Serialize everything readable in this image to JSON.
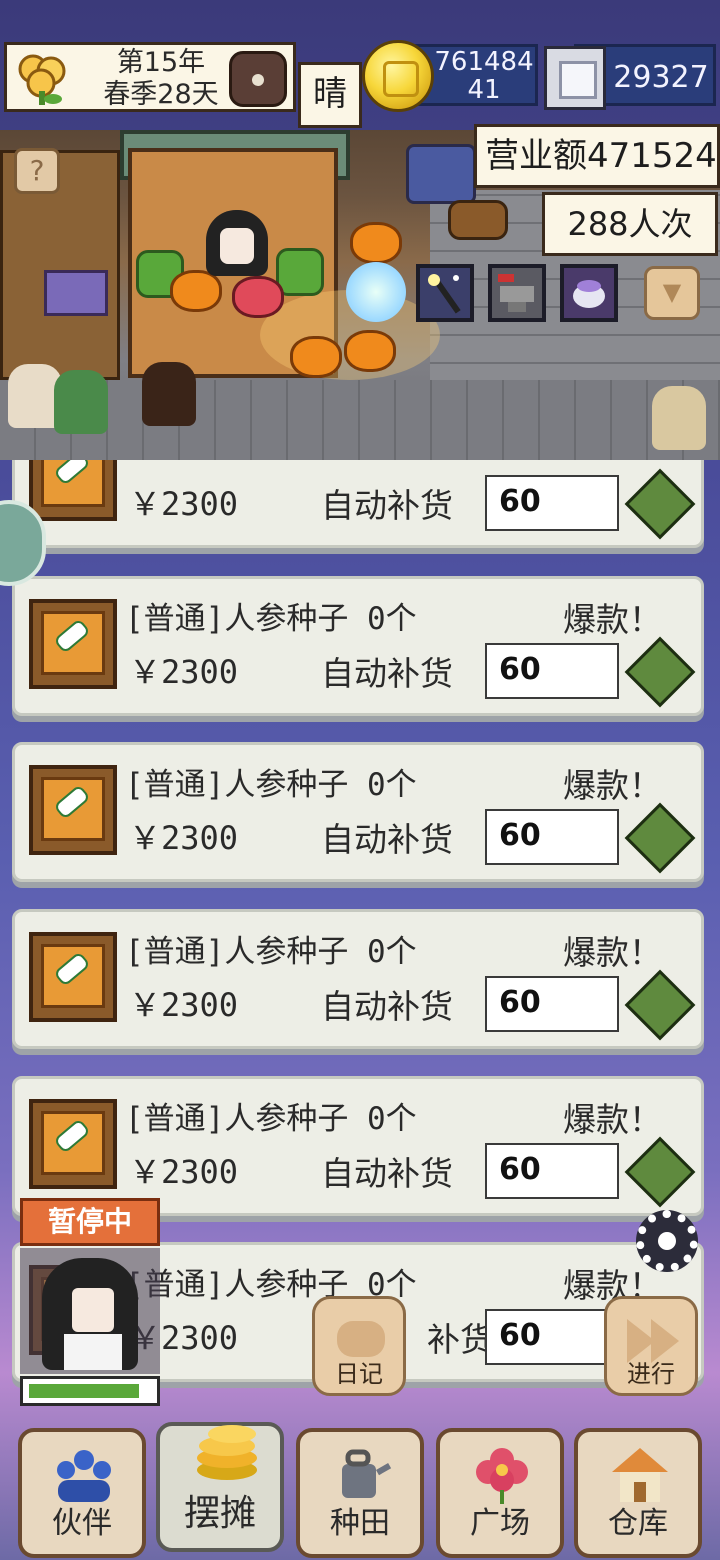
{
  "hud": {
    "date_year": "第15年",
    "date_day": "春季28天",
    "weather": "晴",
    "coins_line1": "761484",
    "coins_line2": "41",
    "gems": "29327",
    "revenue": "营业额471524",
    "visitors": "288人次"
  },
  "scene": {
    "help": "?",
    "collapse": "▼",
    "skill_icons": [
      "wand-icon",
      "anvil-icon",
      "potion-icon"
    ]
  },
  "items": [
    {
      "title": "",
      "hot": "",
      "price": "￥2300",
      "auto_label": "自动补货",
      "qty": "60"
    },
    {
      "title": "[普通]人参种子 0个",
      "hot": "爆款！",
      "price": "￥2300",
      "auto_label": "自动补货",
      "qty": "60"
    },
    {
      "title": "[普通]人参种子 0个",
      "hot": "爆款！",
      "price": "￥2300",
      "auto_label": "自动补货",
      "qty": "60"
    },
    {
      "title": "[普通]人参种子 0个",
      "hot": "爆款！",
      "price": "￥2300",
      "auto_label": "自动补货",
      "qty": "60"
    },
    {
      "title": "[普通]人参种子 0个",
      "hot": "爆款！",
      "price": "￥2300",
      "auto_label": "自动补货",
      "qty": "60"
    },
    {
      "title": "[普通]人参种子 0个",
      "hot": "爆款！",
      "price": "￥2300",
      "auto_label": "补货",
      "qty": "60"
    }
  ],
  "status": {
    "pause": "暂停中",
    "hp_fraction": 0.9
  },
  "actions": {
    "diary": "日记",
    "proceed": "进行"
  },
  "nav": [
    {
      "label": "伙伴",
      "icon": "partners-icon",
      "color": "#3a63c8"
    },
    {
      "label": "摆摊",
      "icon": "coin-stack-icon",
      "color": "#f0b22a"
    },
    {
      "label": "种田",
      "icon": "watering-can-icon",
      "color": "#6e7480"
    },
    {
      "label": "广场",
      "icon": "flower-icon",
      "color": "#e0506a"
    },
    {
      "label": "仓库",
      "icon": "house-icon",
      "color": "#e08a3a"
    }
  ],
  "colors": {
    "accent_pause": "#e4703a",
    "hp_bar": "#5aa83a",
    "diamond_btn": "#5f8a3e",
    "card_bg": "#edeee6"
  }
}
